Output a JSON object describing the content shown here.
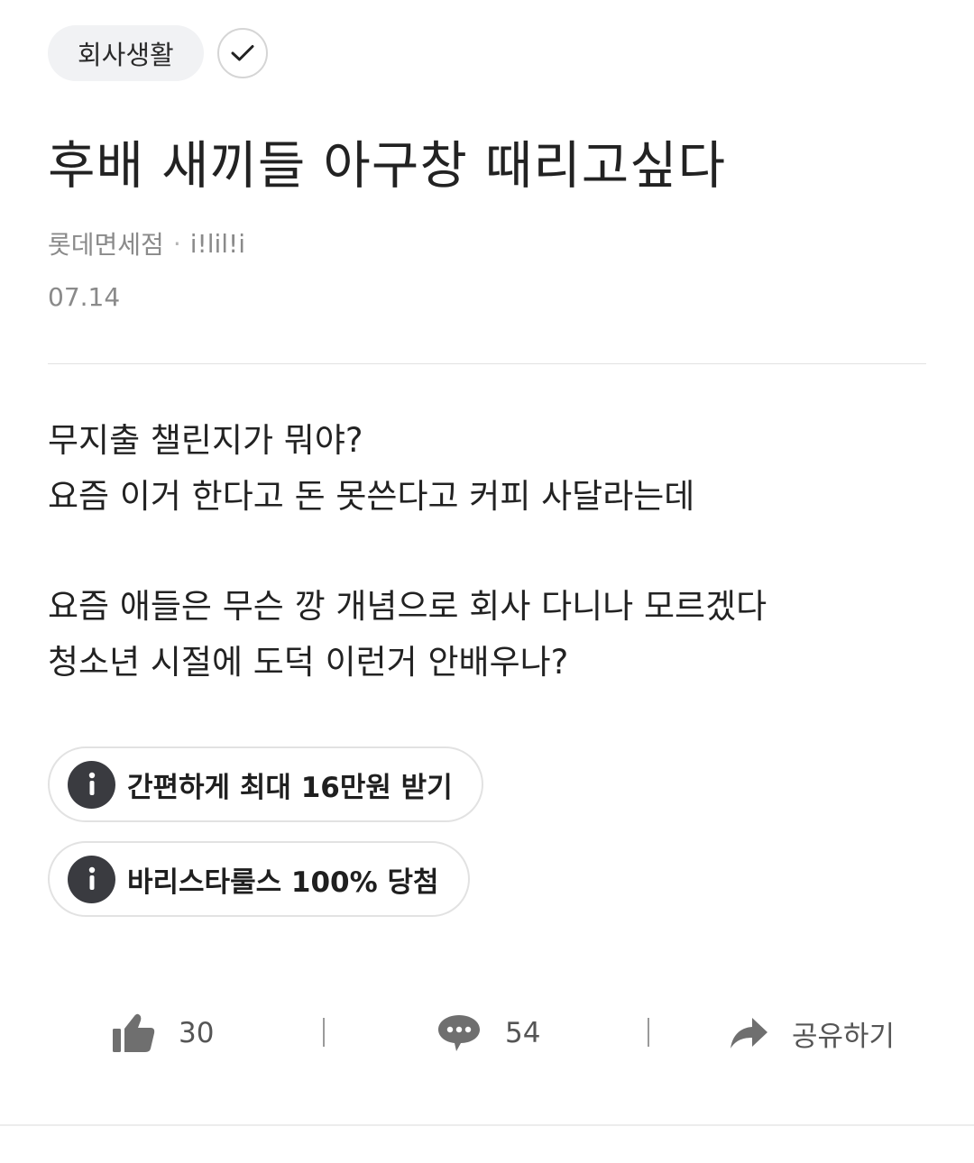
{
  "category": {
    "label": "회사생활"
  },
  "post": {
    "title": "후배 새끼들 아구창 때리고싶다",
    "company": "롯데면세점",
    "author": "i!lil!i",
    "date": "07.14",
    "body": {
      "p1_line1": "무지출 챌린지가 뭐야?",
      "p1_line2": "요즘 이거 한다고 돈 못쓴다고 커피 사달라는데",
      "p2_line1": "요즘 애들은 무슨 깡 개념으로 회사 다니나 모르겠다",
      "p2_line2": "청소년 시절에 도덕 이런거 안배우나?"
    }
  },
  "promos": [
    {
      "label": "간편하게 최대 16만원 받기",
      "icon": "info-icon"
    },
    {
      "label": "바리스타룰스 100% 당첨",
      "icon": "info-icon"
    }
  ],
  "actions": {
    "likes": "30",
    "comments": "54",
    "share_label": "공유하기"
  },
  "colors": {
    "chip_bg": "#f1f2f4",
    "promo_icon_bg": "#3a3b40",
    "meta_text": "#8a8a8a",
    "action_icon": "#6f6f6f"
  }
}
